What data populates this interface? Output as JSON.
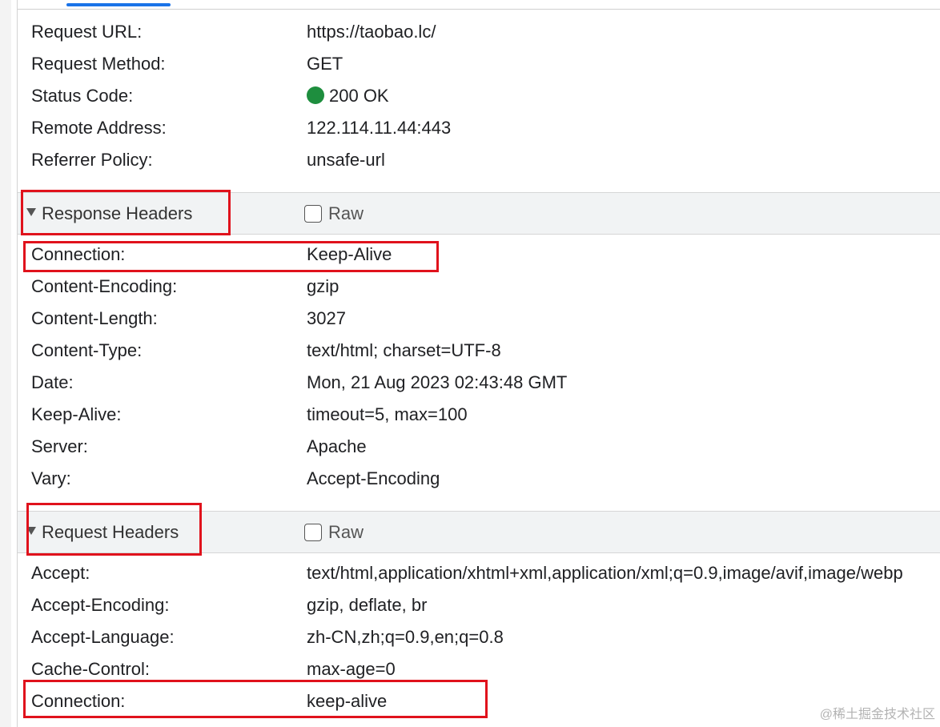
{
  "general": {
    "rows": [
      {
        "key": "Request URL:",
        "value": "https://taobao.lc/"
      },
      {
        "key": "Request Method:",
        "value": "GET"
      },
      {
        "key": "Status Code:",
        "value": "200 OK"
      },
      {
        "key": "Remote Address:",
        "value": "122.114.11.44:443"
      },
      {
        "key": "Referrer Policy:",
        "value": "unsafe-url"
      }
    ]
  },
  "response_headers": {
    "title": "Response Headers",
    "raw_label": "Raw",
    "raw_checked": false,
    "rows": [
      {
        "key": "Connection:",
        "value": "Keep-Alive"
      },
      {
        "key": "Content-Encoding:",
        "value": "gzip"
      },
      {
        "key": "Content-Length:",
        "value": "3027"
      },
      {
        "key": "Content-Type:",
        "value": "text/html; charset=UTF-8"
      },
      {
        "key": "Date:",
        "value": "Mon, 21 Aug 2023 02:43:48 GMT"
      },
      {
        "key": "Keep-Alive:",
        "value": "timeout=5, max=100"
      },
      {
        "key": "Server:",
        "value": "Apache"
      },
      {
        "key": "Vary:",
        "value": "Accept-Encoding"
      }
    ]
  },
  "request_headers": {
    "title": "Request Headers",
    "raw_label": "Raw",
    "raw_checked": false,
    "rows": [
      {
        "key": "Accept:",
        "value": "text/html,application/xhtml+xml,application/xml;q=0.9,image/avif,image/webp"
      },
      {
        "key": "Accept-Encoding:",
        "value": "gzip, deflate, br"
      },
      {
        "key": "Accept-Language:",
        "value": "zh-CN,zh;q=0.9,en;q=0.8"
      },
      {
        "key": "Cache-Control:",
        "value": "max-age=0"
      },
      {
        "key": "Connection:",
        "value": "keep-alive"
      }
    ]
  },
  "watermark": "@稀土掘金技术社区",
  "colors": {
    "status_ok": "#1e8e3e",
    "highlight": "#e0121c",
    "active_tab": "#1a73e8",
    "section_bg": "#f1f3f4"
  }
}
